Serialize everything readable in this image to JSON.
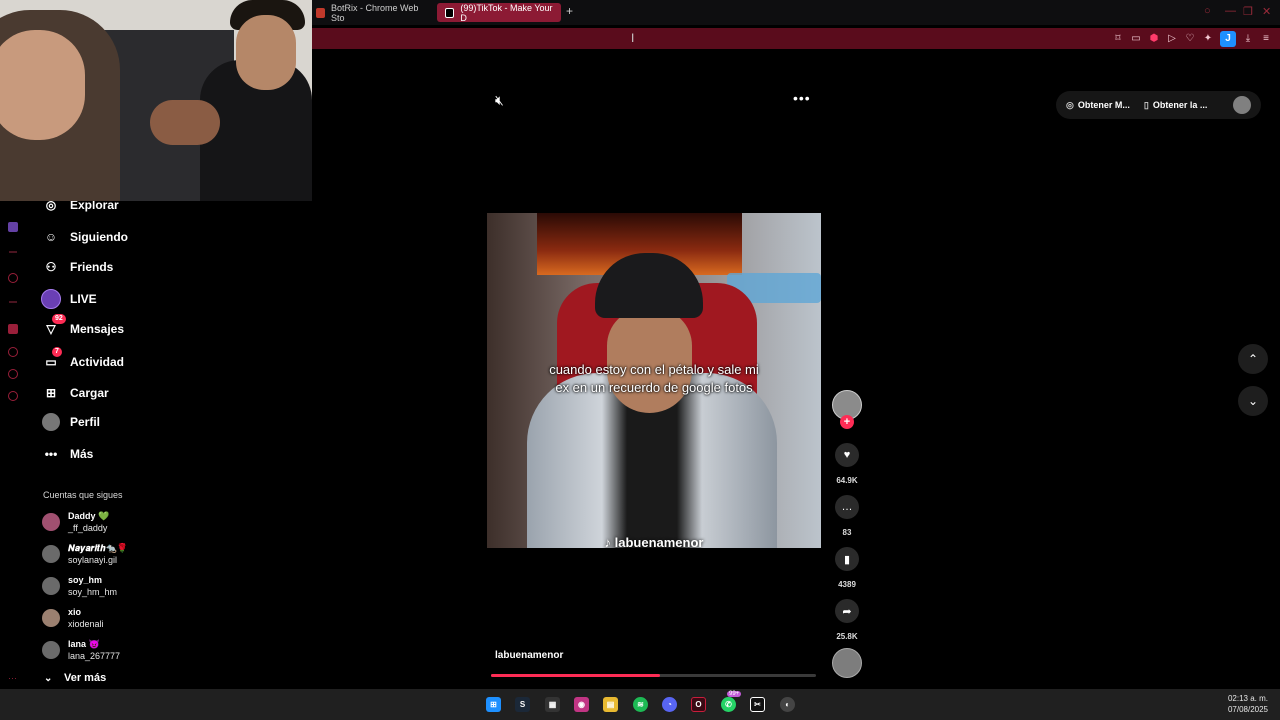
{
  "browser": {
    "tabs": [
      {
        "label": "BotRix - Chrome Web Sto",
        "active": false,
        "icon": "botrix-icon"
      },
      {
        "label": "(99)TikTok - Make Your D",
        "active": true,
        "icon": "tiktok-icon"
      }
    ],
    "new_tab": "+",
    "accent": "#8c1a34"
  },
  "nav": {
    "items": [
      {
        "label": "Explorar",
        "icon": "compass-icon"
      },
      {
        "label": "Siguiendo",
        "icon": "following-icon"
      },
      {
        "label": "Friends",
        "icon": "friends-icon"
      },
      {
        "label": "LIVE",
        "icon": "live-icon"
      },
      {
        "label": "Mensajes",
        "icon": "messages-icon",
        "badge": "92"
      },
      {
        "label": "Actividad",
        "icon": "activity-icon",
        "badge": "7"
      },
      {
        "label": "Cargar",
        "icon": "upload-icon"
      },
      {
        "label": "Perfil",
        "icon": "profile-icon"
      },
      {
        "label": "Más",
        "icon": "more-icon"
      }
    ]
  },
  "following": {
    "heading": "Cuentas que sigues",
    "accounts": [
      {
        "name": "Daddy 💚",
        "handle": "_ff_daddy"
      },
      {
        "name": "𝑵𝒂𝒚𝒂𝒓𝒊𝒕𝒉🐀🌹",
        "handle": "soylanayi.gil"
      },
      {
        "name": "soy_hm",
        "handle": "soy_hm_hm"
      },
      {
        "name": "xio",
        "handle": "xiodenali"
      },
      {
        "name": "lana 😈",
        "handle": "lana_267777"
      }
    ],
    "see_more": "Ver más"
  },
  "video": {
    "caption_line1": "cuando estoy con el pétalo y sale mi",
    "caption_line2": "ex en un recuerdo de google fotos",
    "watermark": "♪ labuenamenor",
    "author": "labuenamenor",
    "progress": 0.52
  },
  "actions": {
    "likes": "64.9K",
    "comments": "83",
    "saves": "4389",
    "shares": "25.8K"
  },
  "top_right": {
    "item1": "Obtener M...",
    "item2": "Obtener la ..."
  },
  "clock": {
    "time": "02:13 a. m.",
    "date": "07/08/2025"
  },
  "taskbar": {
    "whatsapp_badge": "99+"
  }
}
